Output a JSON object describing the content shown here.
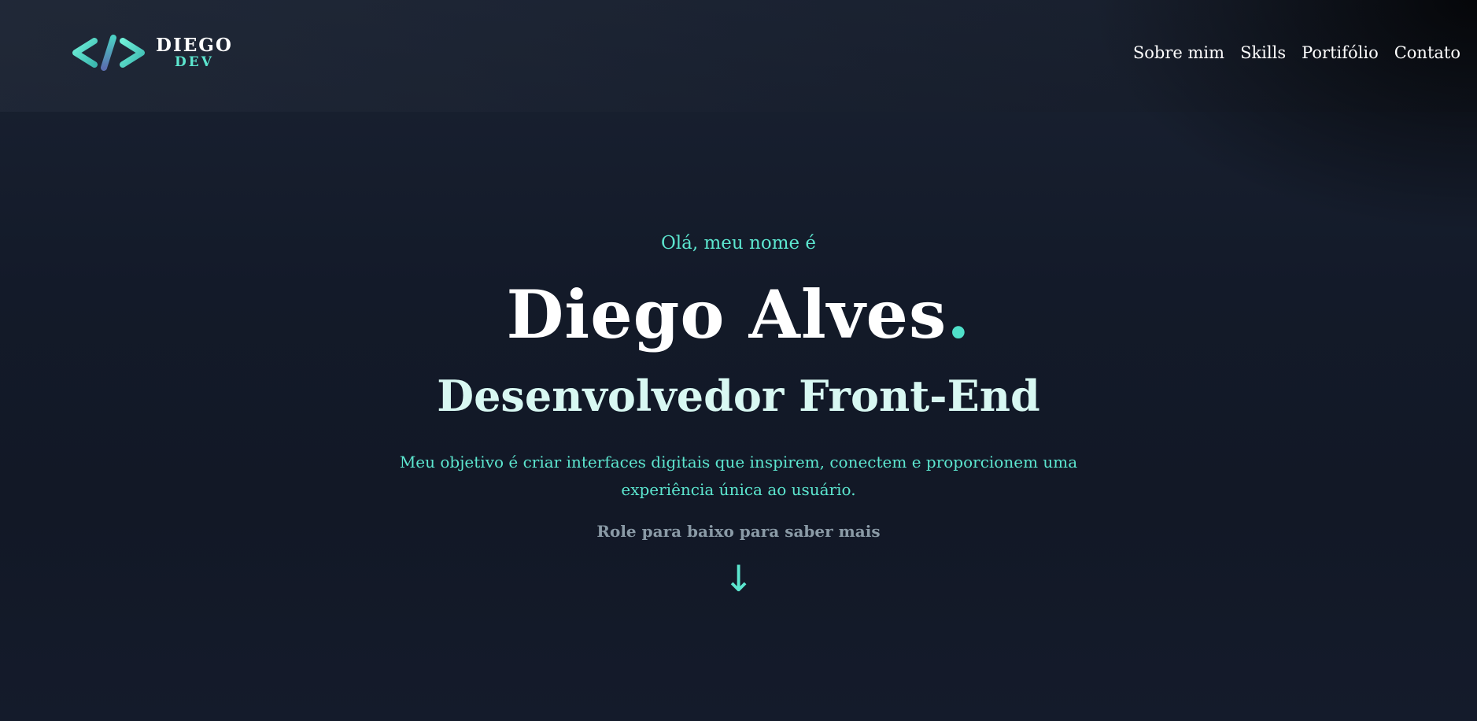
{
  "brand": {
    "name": "DIEGO",
    "sub": "DEV",
    "icon": "code-brackets-icon",
    "colors": {
      "accent": "#5ce6cf",
      "accent_dark": "#3b8ea5"
    }
  },
  "nav": {
    "items": [
      {
        "label": "Sobre mim"
      },
      {
        "label": "Skills"
      },
      {
        "label": "Portifólio"
      },
      {
        "label": "Contato"
      }
    ]
  },
  "hero": {
    "greeting": "Olá, meu nome é",
    "name": "Diego Alves",
    "name_dot": ".",
    "role": "Desenvolvedor Front-End",
    "description_line1": "Meu objetivo é criar interfaces digitais que inspirem, conectem e proporcionem uma",
    "description_line2": "experiência única ao usuário.",
    "scroll_hint": "Role para baixo para saber mais",
    "scroll_icon": "arrow-down-icon",
    "scroll_glyph": "↓"
  },
  "colors": {
    "background": "#141b2b",
    "accent": "#5ce6cf",
    "role_text": "#d8f8f2",
    "muted_text": "#8a9aa6"
  }
}
